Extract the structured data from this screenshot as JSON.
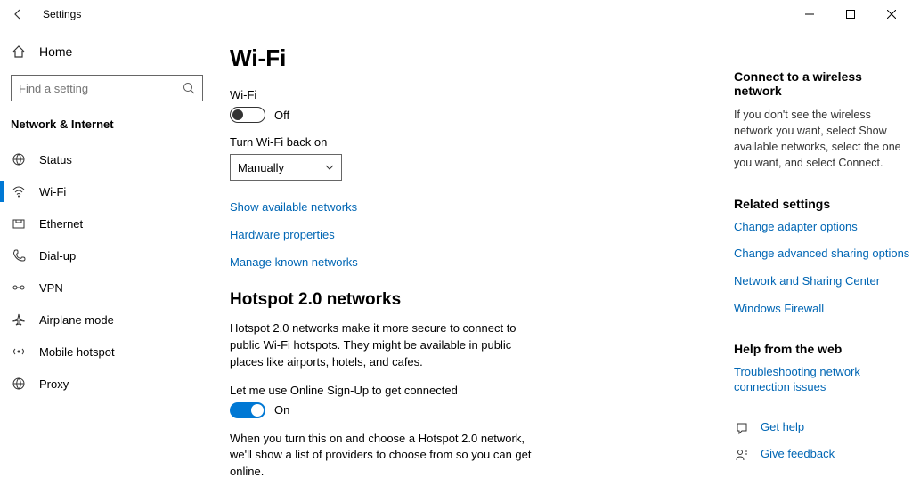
{
  "titlebar": {
    "app": "Settings"
  },
  "sidebar": {
    "home": "Home",
    "search_placeholder": "Find a setting",
    "section": "Network & Internet",
    "items": [
      {
        "label": "Status"
      },
      {
        "label": "Wi-Fi"
      },
      {
        "label": "Ethernet"
      },
      {
        "label": "Dial-up"
      },
      {
        "label": "VPN"
      },
      {
        "label": "Airplane mode"
      },
      {
        "label": "Mobile hotspot"
      },
      {
        "label": "Proxy"
      }
    ]
  },
  "main": {
    "title": "Wi-Fi",
    "wifi_label": "Wi-Fi",
    "wifi_state": "Off",
    "turnback_label": "Turn Wi-Fi back on",
    "turnback_value": "Manually",
    "links": {
      "show_networks": "Show available networks",
      "hardware": "Hardware properties",
      "manage_known": "Manage known networks"
    },
    "hotspot_heading": "Hotspot 2.0 networks",
    "hotspot_desc": "Hotspot 2.0 networks make it more secure to connect to public Wi-Fi hotspots. They might be available in public places like airports, hotels, and cafes.",
    "signup_label": "Let me use Online Sign-Up to get connected",
    "signup_state": "On",
    "signup_desc": "When you turn this on and choose a Hotspot 2.0 network, we'll show a list of providers to choose from so you can get online."
  },
  "right": {
    "connect_heading": "Connect to a wireless network",
    "connect_desc": "If you don't see the wireless network you want, select Show available networks, select the one you want, and select Connect.",
    "related_heading": "Related settings",
    "related_links": {
      "adapter": "Change adapter options",
      "sharing": "Change advanced sharing options",
      "center": "Network and Sharing Center",
      "firewall": "Windows Firewall"
    },
    "help_heading": "Help from the web",
    "help_link": "Troubleshooting network connection issues",
    "get_help": "Get help",
    "give_feedback": "Give feedback"
  }
}
